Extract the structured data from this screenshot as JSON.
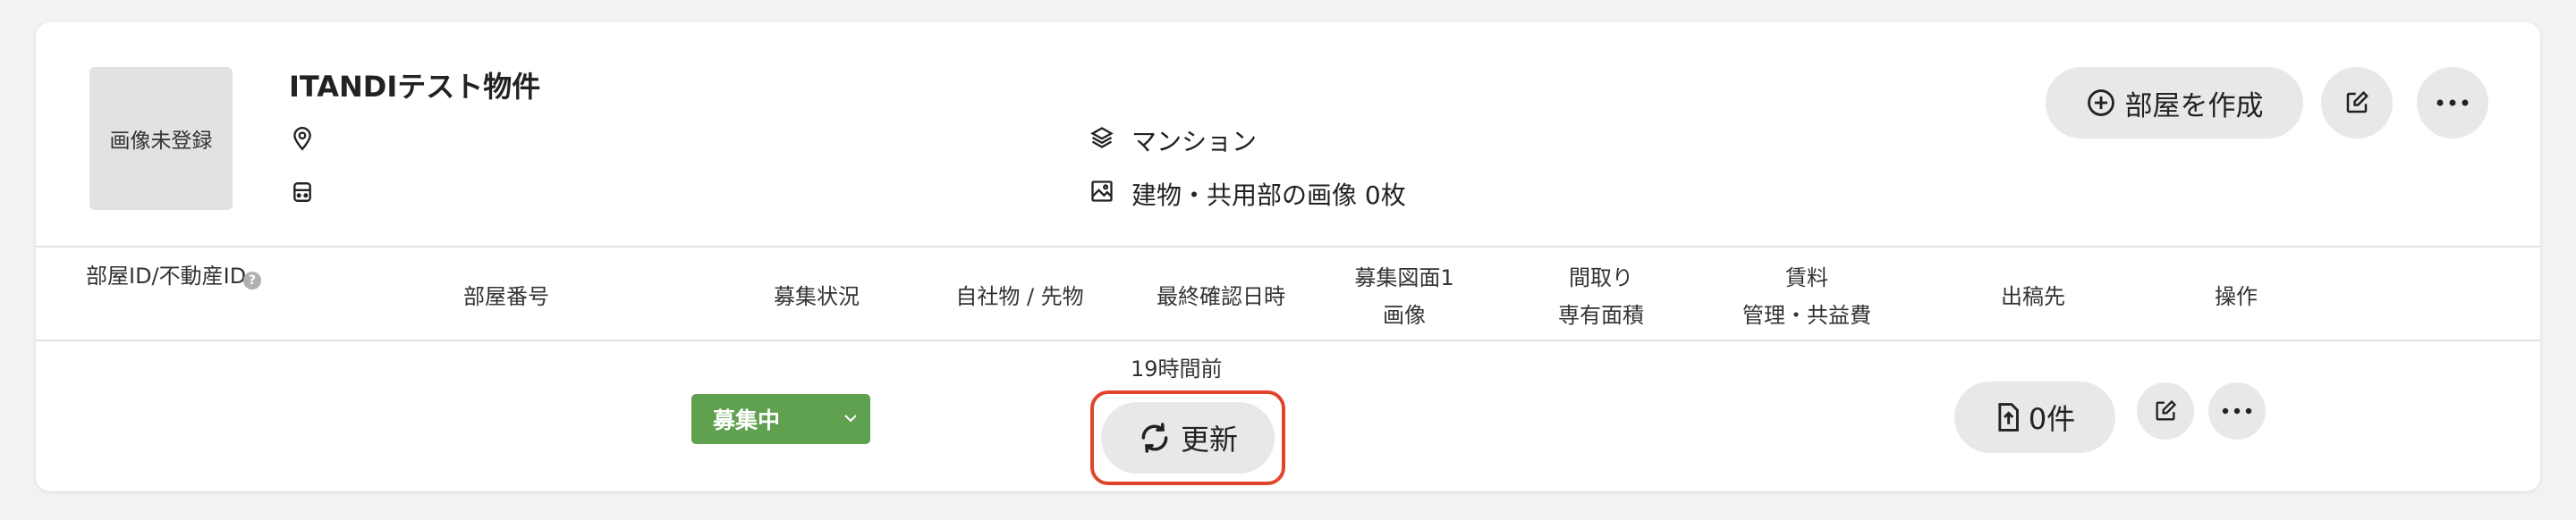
{
  "property": {
    "thumbnail_label": "画像未登録",
    "name": "ITANDIテスト物件",
    "building_type": "マンション",
    "images_label": "建物・共用部の画像 0枚"
  },
  "actions": {
    "create_room_label": "部屋を作成",
    "edit_icon": "edit-icon",
    "more_icon": "more-icon"
  },
  "table": {
    "headers": {
      "room_id": "部屋ID/不動産ID",
      "room_number": "部屋番号",
      "recruit_status": "募集状況",
      "own_or_ahead": "自社物 / 先物",
      "last_confirmed": "最終確認日時",
      "floorplan_line1": "募集図面1",
      "floorplan_line2": "画像",
      "layout_line1": "間取り",
      "layout_line2": "専有面積",
      "rent_line1": "賃料",
      "rent_line2": "管理・共益費",
      "publish_to": "出稿先",
      "operations": "操作"
    },
    "rows": [
      {
        "status": "募集中",
        "last_confirmed_ago": "19時間前",
        "refresh_label": "更新",
        "publish_count": "0件"
      }
    ]
  },
  "colors": {
    "status_green": "#5fa14f",
    "highlight_red": "#e0452c",
    "pill_gray": "#e8e8e8"
  }
}
